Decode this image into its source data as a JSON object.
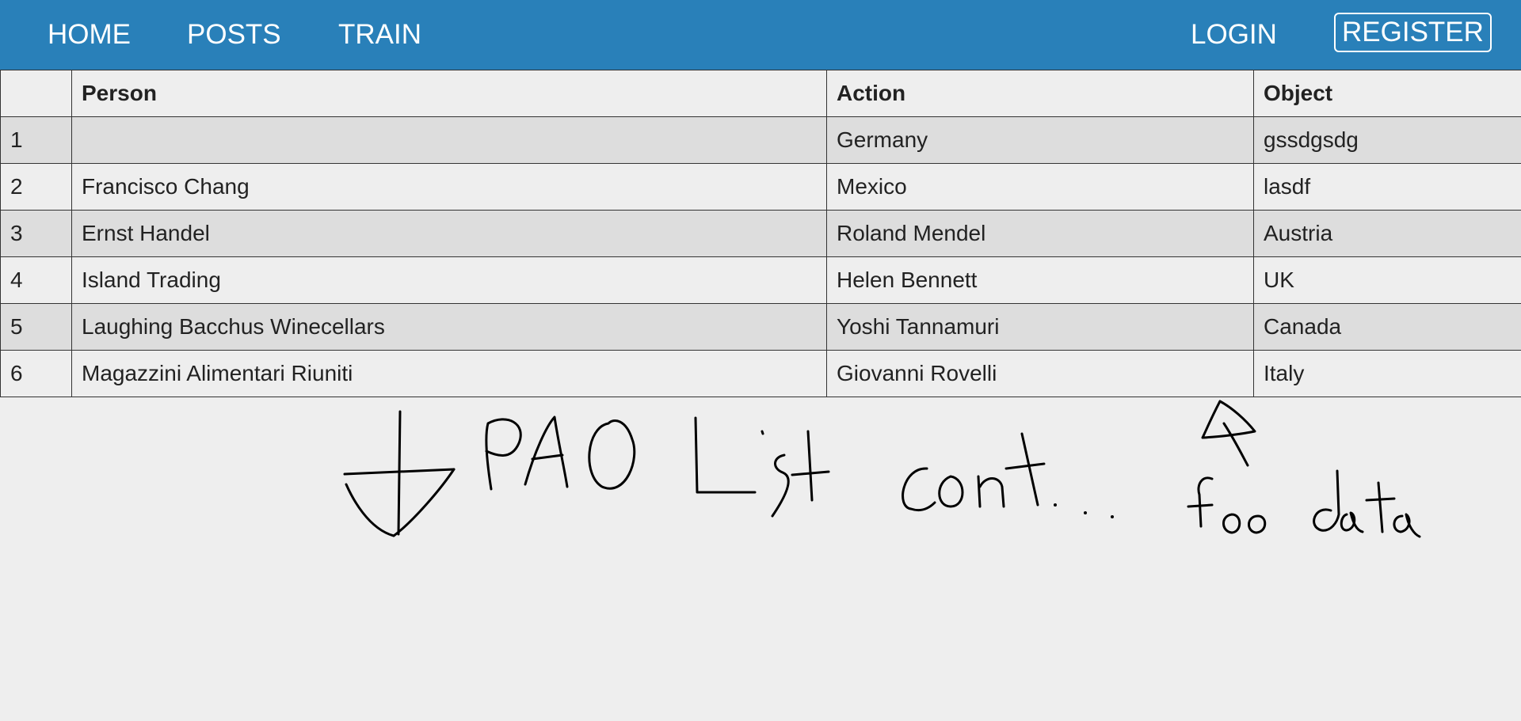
{
  "nav": {
    "home": "HOME",
    "posts": "POSTS",
    "train": "TRAIN",
    "login": "LOGIN",
    "register": "REGISTER"
  },
  "table": {
    "headers": [
      "",
      "Person",
      "Action",
      "Object"
    ],
    "rows": [
      {
        "index": "1",
        "person": "",
        "action": "Germany",
        "object": "gssdgsdg"
      },
      {
        "index": "2",
        "person": "Francisco Chang",
        "action": "Mexico",
        "object": "lasdf"
      },
      {
        "index": "3",
        "person": "Ernst Handel",
        "action": "Roland Mendel",
        "object": "Austria"
      },
      {
        "index": "4",
        "person": "Island Trading",
        "action": "Helen Bennett",
        "object": "UK"
      },
      {
        "index": "5",
        "person": "Laughing Bacchus Winecellars",
        "action": "Yoshi Tannamuri",
        "object": "Canada"
      },
      {
        "index": "6",
        "person": "Magazzini Alimentari Riuniti",
        "action": "Giovanni Rovelli",
        "object": "Italy"
      }
    ]
  },
  "handwriting": {
    "text_1": "PAO List cont...",
    "text_2": "foo data",
    "arrow_icon": "down-arrow-icon",
    "triangle_icon": "triangle-icon"
  },
  "colors": {
    "navbar": "#2980b9",
    "background": "#eeeeee",
    "row_alt": "#dddddd"
  }
}
